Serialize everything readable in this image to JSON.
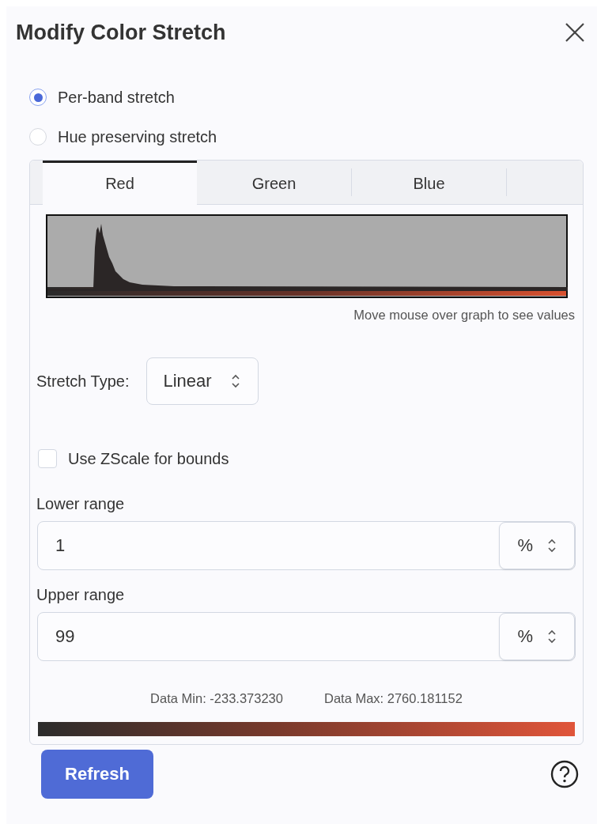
{
  "dialog": {
    "title": "Modify Color Stretch"
  },
  "stretch_modes": [
    {
      "label": "Per-band stretch",
      "selected": true
    },
    {
      "label": "Hue preserving stretch",
      "selected": false
    }
  ],
  "band_tabs": [
    {
      "label": "Red",
      "selected": true
    },
    {
      "label": "Green",
      "selected": false
    },
    {
      "label": "Blue",
      "selected": false
    }
  ],
  "histogram": {
    "kind": "picture",
    "caption": "Move mouse over graph to see values"
  },
  "stretch_type": {
    "label": "Stretch Type:",
    "value": "Linear"
  },
  "zscale": {
    "label": "Use ZScale for bounds",
    "checked": false
  },
  "ranges": [
    {
      "label": "Lower range",
      "value": "1",
      "unit": "%"
    },
    {
      "label": "Upper range",
      "value": "99",
      "unit": "%"
    }
  ],
  "data_min": "Data Min: -233.373230",
  "data_max": "Data Max: 2760.181152",
  "refresh_button": "Refresh"
}
